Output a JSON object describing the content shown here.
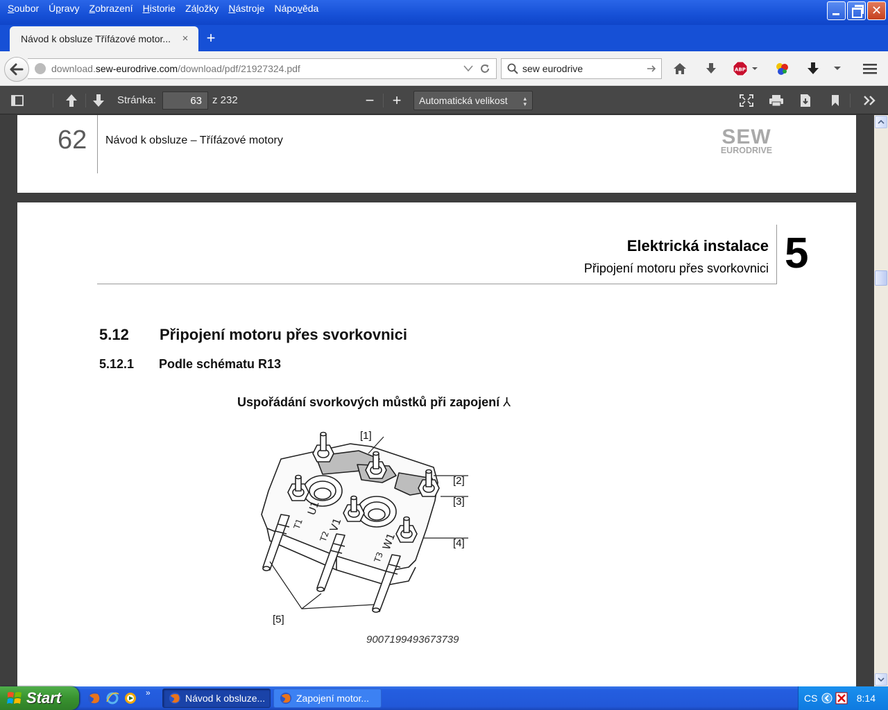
{
  "menu": [
    {
      "label": "Soubor",
      "key": "S"
    },
    {
      "label": "Úpravy",
      "key": "p"
    },
    {
      "label": "Zobrazení",
      "key": "Z"
    },
    {
      "label": "Historie",
      "key": "H"
    },
    {
      "label": "Záložky",
      "key": "l"
    },
    {
      "label": "Nástroje",
      "key": "N"
    },
    {
      "label": "Nápověda",
      "key": "v"
    }
  ],
  "tab": {
    "title": "Návod k obsluze Třífázové motor...",
    "close": "×",
    "new": "+"
  },
  "url": {
    "prefix": "download.",
    "domain": "sew-eurodrive.com",
    "path": "/download/pdf/21927324.pdf"
  },
  "search": {
    "value": "sew eurodrive"
  },
  "pdf_toolbar": {
    "page_label": "Stránka:",
    "page_value": "63",
    "page_total": "z 232",
    "zoom": "Automatická velikost",
    "zoom_out": "−",
    "zoom_in": "+"
  },
  "page62": {
    "number": "62",
    "title": "Návod k obsluze – Třífázové motory",
    "logo_top": "SEW",
    "logo_bottom": "EURODRIVE"
  },
  "page63": {
    "header_title": "Elektrická instalace",
    "header_subtitle": "Připojení motoru přes svorkovnici",
    "chapter": "5",
    "section_number": "5.12",
    "section_title": "Připojení motoru přes svorkovnici",
    "subsection_number": "5.12.1",
    "subsection_title": "Podle schématu R13",
    "figure_caption": "Uspořádání svorkových můstků při zapojení",
    "figure_symbol": "⅄",
    "callouts": [
      "[1]",
      "[2]",
      "[3]",
      "[4]",
      "[5]"
    ],
    "terminal_labels": [
      "U1",
      "V1",
      "W1",
      "T1",
      "T2",
      "T3"
    ],
    "figure_id": "9007199493673739"
  },
  "taskbar": {
    "start": "Start",
    "more": "»",
    "tasks": [
      "Návod k obsluze...",
      "Zapojení motor..."
    ],
    "lang": "CS",
    "clock": "8:14"
  },
  "colors": {
    "accent": "#1650d6",
    "pdf_toolbar": "#474747",
    "abp": "#c8102e"
  }
}
